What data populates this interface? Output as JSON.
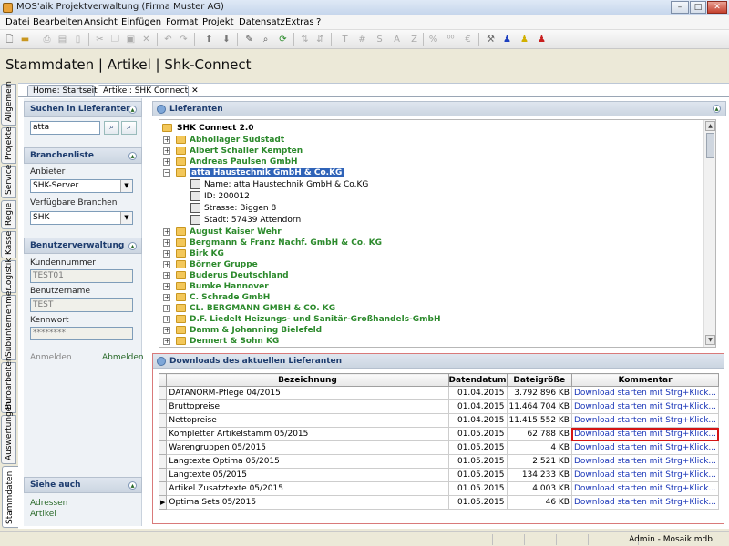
{
  "window": {
    "title": "MOS'aik Projektverwaltung (Firma Muster AG)",
    "buttons": {
      "minimize": "–",
      "maximize": "□",
      "close": "✕"
    }
  },
  "menu": [
    "Datei",
    "Bearbeiten",
    "Ansicht",
    "Einfügen",
    "Format",
    "Projekt",
    "Datensatz",
    "Extras",
    "?"
  ],
  "toolbar": {
    "text_buttons": [
      "T",
      "#",
      "S",
      "A",
      "Z",
      "%",
      "",
      "€"
    ]
  },
  "page_title": "Stammdaten | Artikel | Shk-Connect",
  "vertical_tabs": [
    "Allgemein",
    "Projekte",
    "Service",
    "Regie",
    "Kasse",
    "Logistik",
    "Subunternehmer",
    "Büroarbeiten",
    "Auswertungen",
    "Stammdaten"
  ],
  "doc_tabs": [
    {
      "label": "Home: Startseite"
    },
    {
      "label": "Artikel: SHK Connect",
      "close": "✕"
    }
  ],
  "left_panel": {
    "search": {
      "title": "Suchen in Lieferanten",
      "value": "atta"
    },
    "branches": {
      "title": "Branchenliste",
      "provider_label": "Anbieter",
      "provider_value": "SHK-Server",
      "available_label": "Verfügbare Branchen",
      "available_value": "SHK"
    },
    "user_admin": {
      "title": "Benutzerverwaltung",
      "customer_no_label": "Kundennummer",
      "customer_no_value": "TEST01",
      "username_label": "Benutzername",
      "username_value": "TEST",
      "password_label": "Kennwort",
      "password_value": "********",
      "login": "Anmelden",
      "logout": "Abmelden"
    },
    "see_also": {
      "title": "Siehe auch",
      "links": [
        "Adressen",
        "Artikel"
      ]
    }
  },
  "suppliers": {
    "title": "Lieferanten",
    "root": "SHK Connect 2.0",
    "items": [
      "Abhollager Südstadt",
      "Albert Schaller Kempten",
      "Andreas Paulsen GmbH",
      "atta Haustechnik GmbH & Co.KG",
      "August Kaiser Wehr",
      "Bergmann & Franz Nachf. GmbH & Co. KG",
      "Birk KG",
      "Börner Gruppe",
      "Buderus Deutschland",
      "Bumke Hannover",
      "C. Schrade GmbH",
      "CL. BERGMANN GMBH & CO. KG",
      "D.F. Liedelt Heizungs- und Sanitär-Großhandels-GmbH",
      "Damm & Johanning Bielefeld",
      "Dennert & Sohn KG"
    ],
    "details": [
      "Name: atta Haustechnik GmbH & Co.KG",
      "ID: 200012",
      "Strasse: Biggen 8",
      "Stadt: 57439 Attendorn"
    ]
  },
  "downloads": {
    "title": "Downloads des aktuellen Lieferanten",
    "columns": [
      "Bezeichnung",
      "Datendatum",
      "Dateigröße",
      "Kommentar"
    ],
    "rows": [
      [
        "DATANORM-Pflege 04/2015",
        "01.04.2015",
        "3.792.896 KB",
        "Download starten mit Strg+Klick..."
      ],
      [
        "Bruttopreise",
        "01.04.2015",
        "11.464.704 KB",
        "Download starten mit Strg+Klick..."
      ],
      [
        "Nettopreise",
        "01.04.2015",
        "11.415.552 KB",
        "Download starten mit Strg+Klick..."
      ],
      [
        "Kompletter Artikelstamm 05/2015",
        "01.05.2015",
        "62.788 KB",
        "Download starten mit Strg+Klick..."
      ],
      [
        "Warengruppen 05/2015",
        "01.05.2015",
        "4 KB",
        "Download starten mit Strg+Klick..."
      ],
      [
        "Langtexte Optima 05/2015",
        "01.05.2015",
        "2.521 KB",
        "Download starten mit Strg+Klick..."
      ],
      [
        "Langtexte 05/2015",
        "01.05.2015",
        "134.233 KB",
        "Download starten mit Strg+Klick..."
      ],
      [
        "Artikel Zusatztexte 05/2015",
        "01.05.2015",
        "4.003 KB",
        "Download starten mit Strg+Klick..."
      ],
      [
        "Optima Sets 05/2015",
        "01.05.2015",
        "46 KB",
        "Download starten mit Strg+Klick..."
      ]
    ],
    "current_row_marker": "▶"
  },
  "status": {
    "text": "Admin - Mosaik.mdb"
  }
}
